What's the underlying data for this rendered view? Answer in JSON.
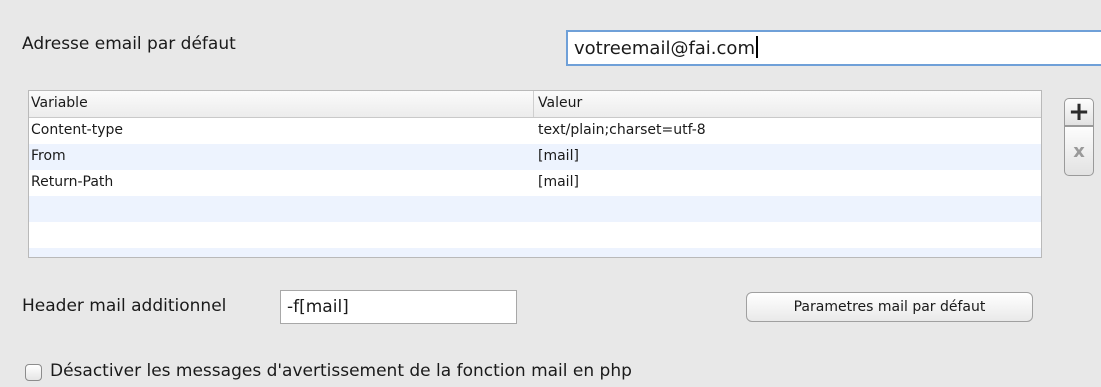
{
  "email_default": {
    "label": "Adresse email par défaut",
    "value": "votreemail@fai.com"
  },
  "variables_table": {
    "columns": [
      "Variable",
      "Valeur"
    ],
    "rows": [
      {
        "variable": "Content-type",
        "valeur": "text/plain;charset=utf-8"
      },
      {
        "variable": "From",
        "valeur": "[mail]"
      },
      {
        "variable": "Return-Path",
        "valeur": "[mail]"
      }
    ]
  },
  "table_buttons": {
    "add_symbol": "+",
    "remove_symbol": "x"
  },
  "header_mail": {
    "label": "Header mail additionnel",
    "value": "-f[mail]"
  },
  "defaults_button": {
    "label": "Parametres mail par défaut"
  },
  "warnings_checkbox": {
    "label": "Désactiver les messages d'avertissement de la fonction mail en php",
    "checked": false
  },
  "colors": {
    "background": "#e8e8e8",
    "focus_ring": "#6fa0d8",
    "row_alternate": "#edf3fe"
  }
}
